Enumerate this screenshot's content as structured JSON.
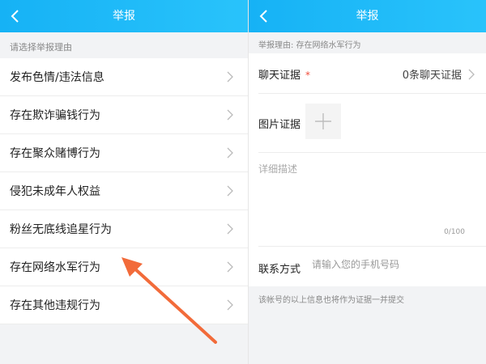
{
  "left": {
    "header": {
      "title": "举报"
    },
    "hint": "请选择举报理由",
    "reasons": [
      {
        "label": "发布色情/违法信息"
      },
      {
        "label": "存在欺诈骗钱行为"
      },
      {
        "label": "存在聚众赌博行为"
      },
      {
        "label": "侵犯未成年人权益"
      },
      {
        "label": "粉丝无底线追星行为"
      },
      {
        "label": "存在网络水军行为"
      },
      {
        "label": "存在其他违规行为"
      }
    ]
  },
  "right": {
    "header": {
      "title": "举报"
    },
    "reason_line": "举报理由:  存在网络水军行为",
    "chat_evidence": {
      "label": "聊天证据",
      "required_mark": "*",
      "value": "0条聊天证据"
    },
    "image_evidence": {
      "label": "图片证据"
    },
    "description": {
      "placeholder": "详细描述",
      "counter": "0/100"
    },
    "contact": {
      "label": "联系方式",
      "placeholder": "请输入您的手机号码"
    },
    "footnote": "该帐号的以上信息也将作为证据一并提交"
  },
  "colors": {
    "header": "#1ab8f7",
    "arrow": "#f26b3a",
    "required": "#f04d3c"
  }
}
